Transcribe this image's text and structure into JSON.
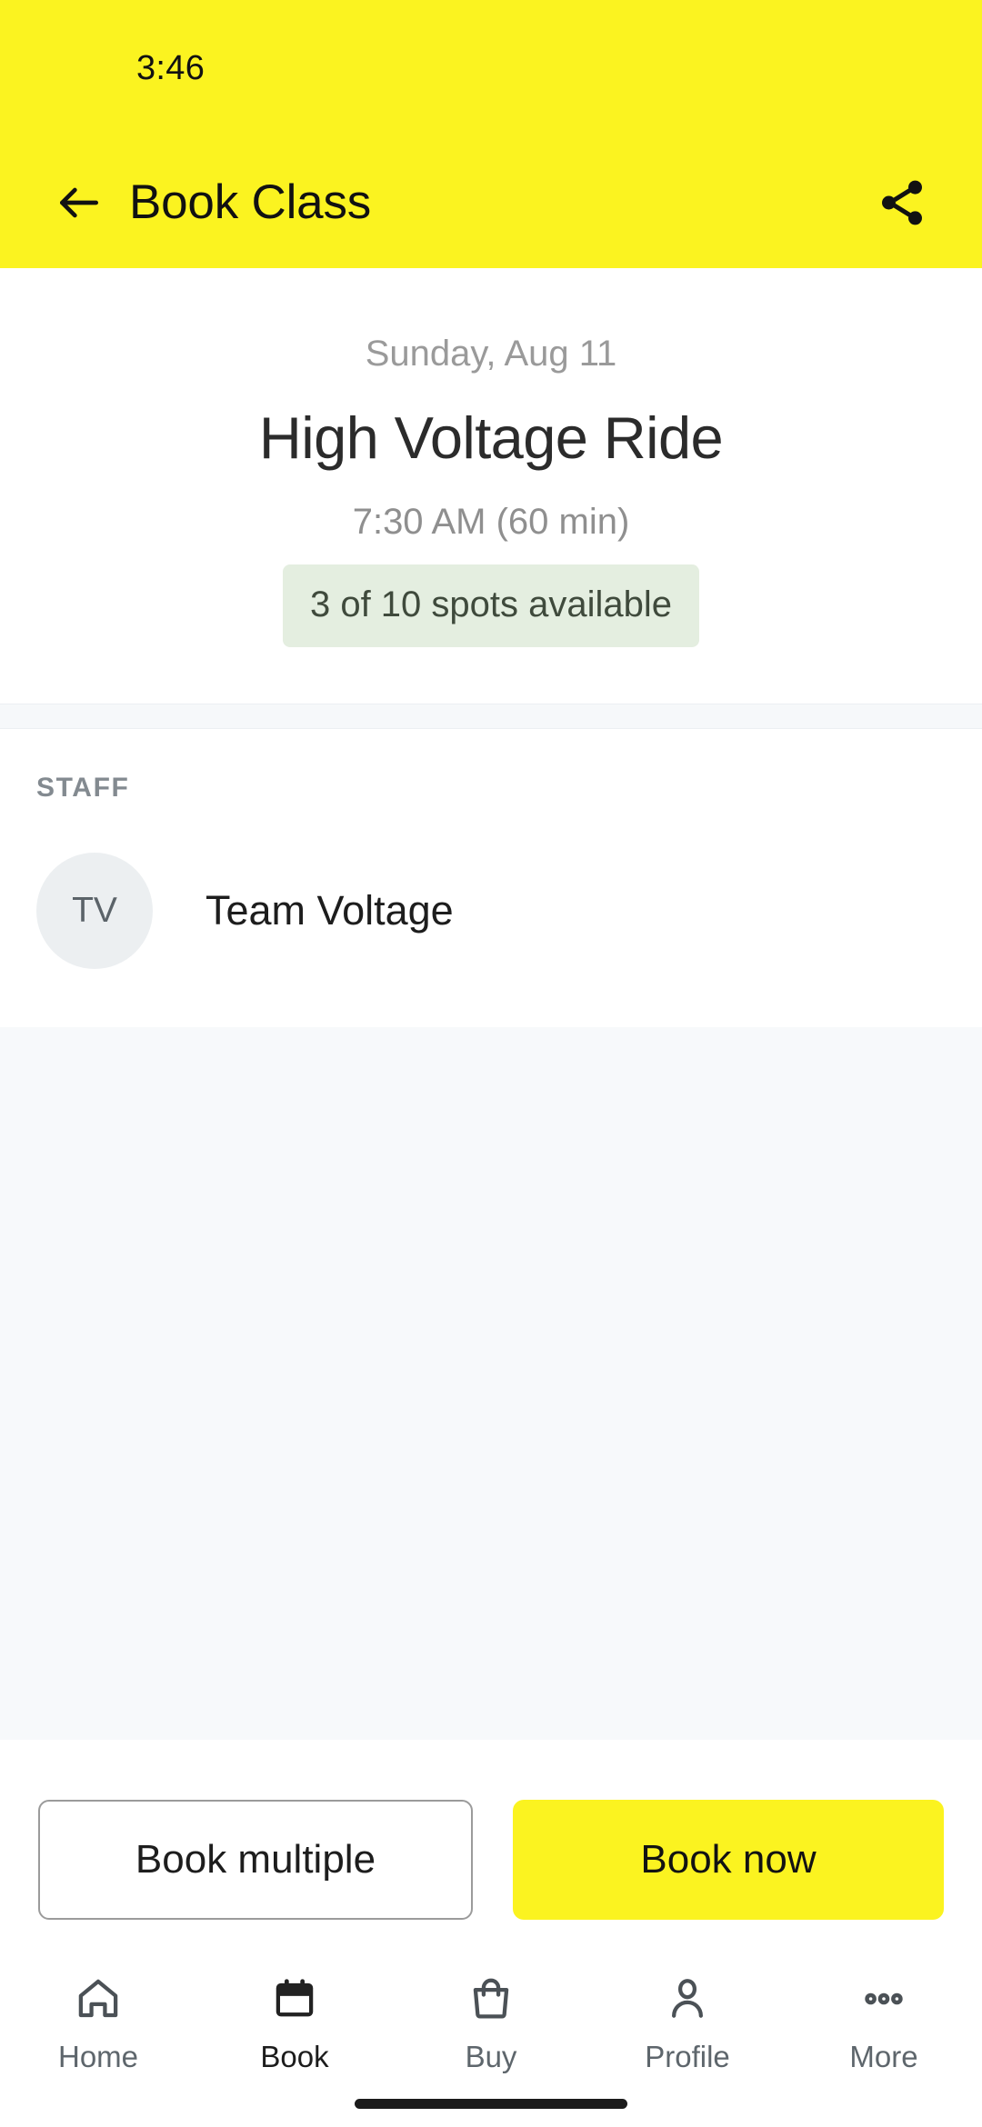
{
  "status_bar": {
    "time": "3:46"
  },
  "app_bar": {
    "title": "Book Class",
    "back_icon": "arrow-left-icon",
    "share_icon": "share-icon"
  },
  "theme": {
    "accent_yellow": "#fbf320",
    "badge_green_bg": "#e4eee0",
    "badge_green_text": "#3f4a3c",
    "muted_text": "#9a9a9a",
    "surface_gray": "#f7f9fb"
  },
  "class_details": {
    "date": "Sunday, Aug 11",
    "name": "High Voltage Ride",
    "time_and_duration": "7:30 AM (60 min)",
    "availability": "3 of 10 spots available",
    "spots_available": 3,
    "spots_total": 10
  },
  "staff_section": {
    "label": "STAFF",
    "members": [
      {
        "initials": "TV",
        "name": "Team Voltage"
      }
    ]
  },
  "actions": {
    "secondary_label": "Book multiple",
    "primary_label": "Book now"
  },
  "bottom_nav": {
    "items": [
      {
        "label": "Home",
        "icon": "home-icon",
        "active": false
      },
      {
        "label": "Book",
        "icon": "calendar-icon",
        "active": true
      },
      {
        "label": "Buy",
        "icon": "bag-icon",
        "active": false
      },
      {
        "label": "Profile",
        "icon": "person-icon",
        "active": false
      },
      {
        "label": "More",
        "icon": "ellipsis-icon",
        "active": false
      }
    ]
  }
}
